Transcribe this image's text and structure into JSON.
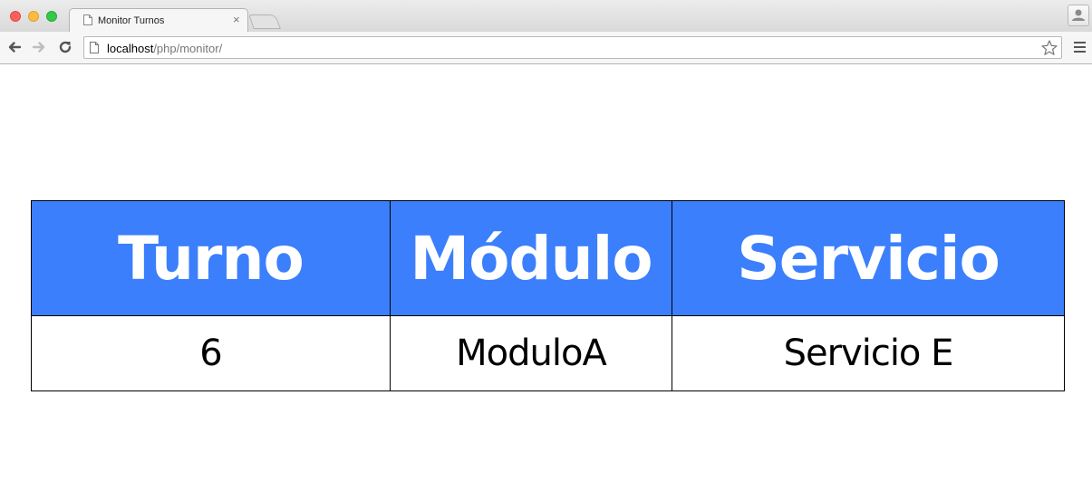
{
  "browser": {
    "tab_title": "Monitor Turnos",
    "tab_close": "×",
    "url_host": "localhost",
    "url_path": "/php/monitor/"
  },
  "table": {
    "headers": [
      "Turno",
      "Módulo",
      "Servicio"
    ],
    "rows": [
      [
        "6",
        "ModuloA",
        "Servicio E"
      ]
    ]
  },
  "colors": {
    "header_background": "#3b7ffc",
    "header_text": "#ffffff",
    "cell_text": "#000000",
    "border": "#000000"
  },
  "icons": {
    "window_controls": [
      "close-icon",
      "minimize-icon",
      "maximize-icon"
    ],
    "tab": "page-icon",
    "toolbar": [
      "back-arrow-icon",
      "forward-arrow-icon",
      "reload-icon"
    ],
    "omnibox": [
      "page-icon",
      "star-icon"
    ],
    "menu": "hamburger-menu-icon",
    "profile": "user-icon"
  }
}
